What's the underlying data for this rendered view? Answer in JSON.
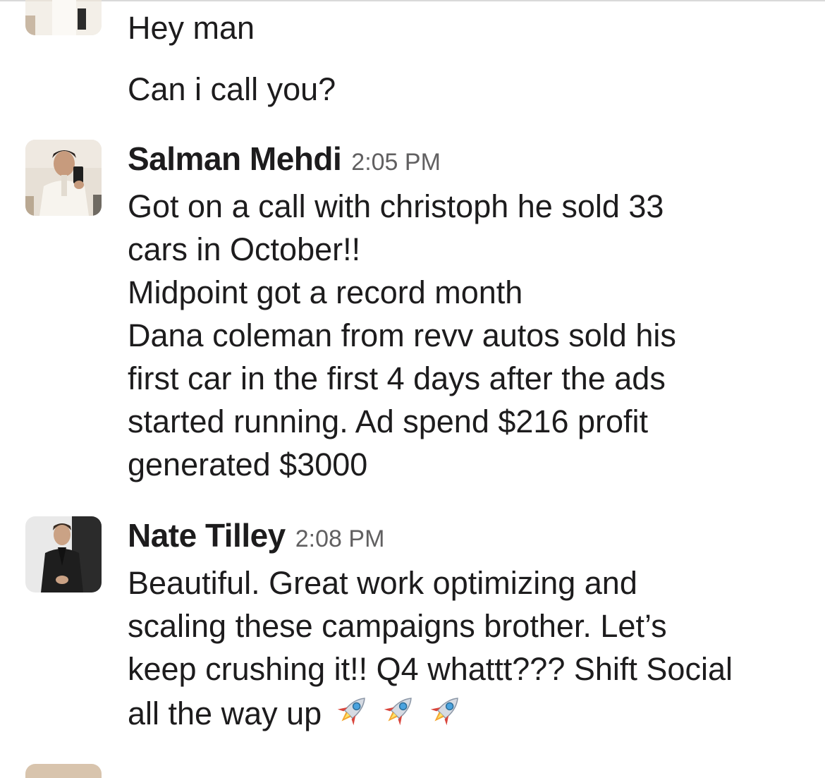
{
  "messages": [
    {
      "author": "",
      "time": "",
      "lines": [
        "Hey man"
      ]
    },
    {
      "author": "",
      "time": "",
      "lines": [
        "Can i call you?"
      ]
    },
    {
      "author": "Salman Mehdi",
      "time": "2:05 PM",
      "avatar_icon": "user-photo-avatar",
      "lines": [
        "Got on a call with christoph he sold 33",
        "cars in October!!",
        "Midpoint got a record month",
        "Dana coleman from revv autos sold his",
        "first car in the first 4 days after the ads",
        "started running. Ad spend $216 profit",
        "generated $3000"
      ]
    },
    {
      "author": "Nate Tilley",
      "time": "2:08 PM",
      "avatar_icon": "user-photo-avatar",
      "lines": [
        "Beautiful. Great work optimizing and",
        "scaling these campaigns brother. Let’s",
        "keep crushing it!! Q4 whattt??? Shift Social",
        "all the way up"
      ],
      "emojis": [
        "rocket-icon",
        "rocket-icon",
        "rocket-icon"
      ]
    }
  ],
  "colors": {
    "text": "#1d1c1d",
    "timestamp": "#616061",
    "background": "#ffffff"
  }
}
